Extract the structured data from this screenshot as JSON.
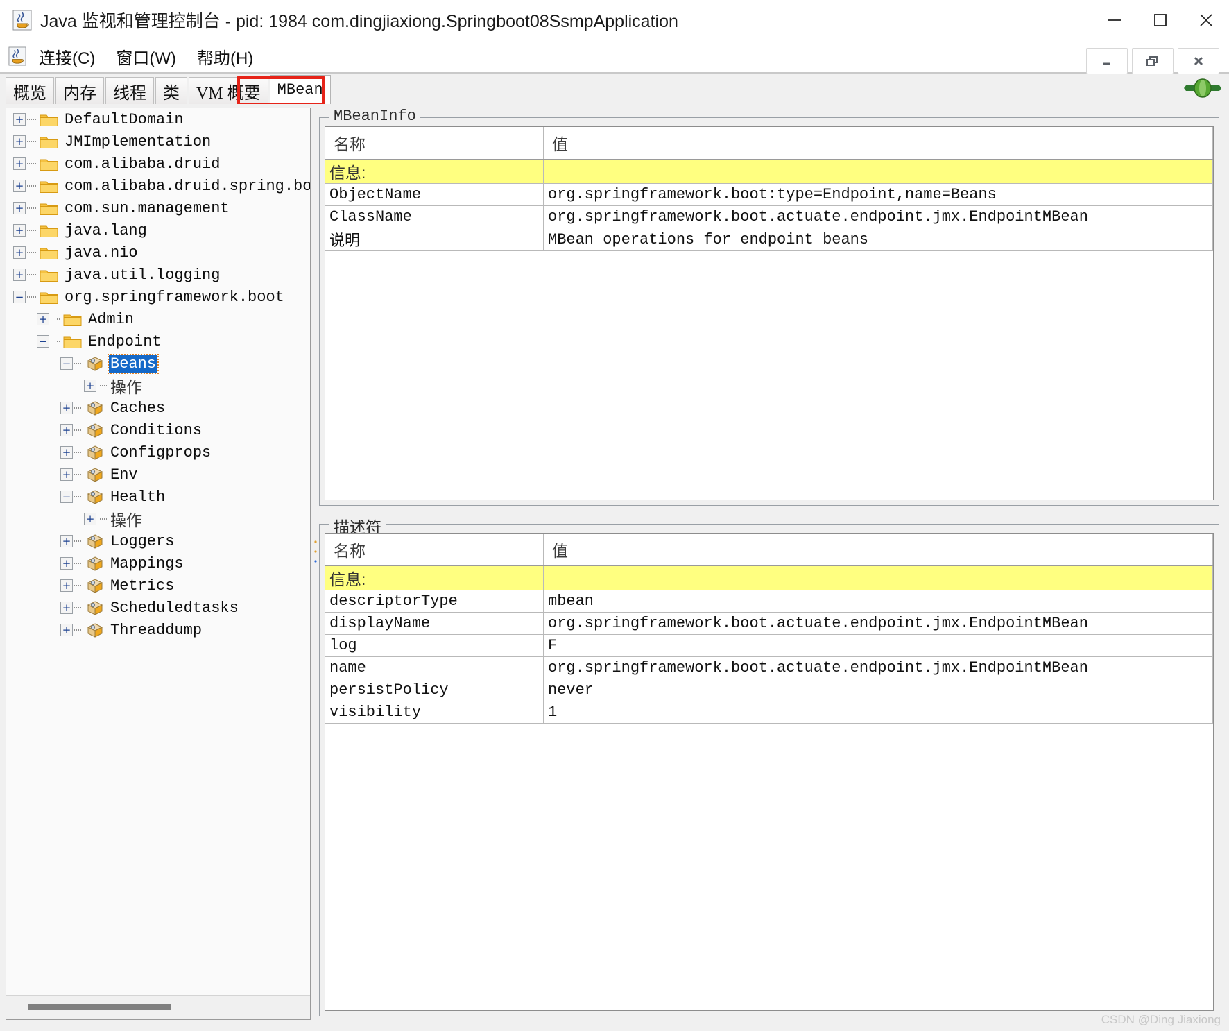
{
  "window": {
    "title": "Java 监视和管理控制台 - pid: 1984 com.dingjiaxiong.Springboot08SsmpApplication",
    "app_icon": "java-cup-icon",
    "controls": [
      {
        "name": "minimize-button",
        "glyph": "minimize-icon"
      },
      {
        "name": "maximize-button",
        "glyph": "maximize-icon"
      },
      {
        "name": "close-button",
        "glyph": "close-icon"
      }
    ]
  },
  "menubar": {
    "icon": "java-cup-icon",
    "items": [
      {
        "label": "连接(C)",
        "name": "menu-connection"
      },
      {
        "label": "窗口(W)",
        "name": "menu-window"
      },
      {
        "label": "帮助(H)",
        "name": "menu-help"
      }
    ],
    "mdi_controls": [
      {
        "name": "mdi-minimize-button",
        "glyph": "minimize-icon"
      },
      {
        "name": "mdi-restore-button",
        "glyph": "restore-icon"
      },
      {
        "name": "mdi-close-button",
        "glyph": "close-icon"
      }
    ]
  },
  "tabs": {
    "items": [
      {
        "label": "概览",
        "active": false
      },
      {
        "label": "内存",
        "active": false
      },
      {
        "label": "线程",
        "active": false
      },
      {
        "label": "类",
        "active": false
      },
      {
        "label": "VM 概要",
        "active": false
      },
      {
        "label": "MBean",
        "active": true
      }
    ],
    "highlight_color": "#e62419",
    "connector_icon": "connector-plug-icon"
  },
  "tree": {
    "nodes": [
      {
        "label": "DefaultDomain",
        "indent": 0,
        "toggle": "+",
        "icon": "folder-icon"
      },
      {
        "label": "JMImplementation",
        "indent": 0,
        "toggle": "+",
        "icon": "folder-icon"
      },
      {
        "label": "com.alibaba.druid",
        "indent": 0,
        "toggle": "+",
        "icon": "folder-icon"
      },
      {
        "label": "com.alibaba.druid.spring.boot.",
        "indent": 0,
        "toggle": "+",
        "icon": "folder-icon"
      },
      {
        "label": "com.sun.management",
        "indent": 0,
        "toggle": "+",
        "icon": "folder-icon"
      },
      {
        "label": "java.lang",
        "indent": 0,
        "toggle": "+",
        "icon": "folder-icon"
      },
      {
        "label": "java.nio",
        "indent": 0,
        "toggle": "+",
        "icon": "folder-icon"
      },
      {
        "label": "java.util.logging",
        "indent": 0,
        "toggle": "+",
        "icon": "folder-icon"
      },
      {
        "label": "org.springframework.boot",
        "indent": 0,
        "toggle": "-",
        "icon": "folder-icon"
      },
      {
        "label": "Admin",
        "indent": 1,
        "toggle": "+",
        "icon": "folder-icon"
      },
      {
        "label": "Endpoint",
        "indent": 1,
        "toggle": "-",
        "icon": "folder-icon"
      },
      {
        "label": "Beans",
        "indent": 2,
        "toggle": "-",
        "icon": "mbean-icon",
        "selected": true
      },
      {
        "label": "操作",
        "indent": 3,
        "toggle": "+",
        "icon": "none",
        "cjk": true
      },
      {
        "label": "Caches",
        "indent": 2,
        "toggle": "+",
        "icon": "mbean-icon"
      },
      {
        "label": "Conditions",
        "indent": 2,
        "toggle": "+",
        "icon": "mbean-icon"
      },
      {
        "label": "Configprops",
        "indent": 2,
        "toggle": "+",
        "icon": "mbean-icon"
      },
      {
        "label": "Env",
        "indent": 2,
        "toggle": "+",
        "icon": "mbean-icon"
      },
      {
        "label": "Health",
        "indent": 2,
        "toggle": "-",
        "icon": "mbean-icon"
      },
      {
        "label": "操作",
        "indent": 3,
        "toggle": "+",
        "icon": "none",
        "cjk": true
      },
      {
        "label": "Loggers",
        "indent": 2,
        "toggle": "+",
        "icon": "mbean-icon"
      },
      {
        "label": "Mappings",
        "indent": 2,
        "toggle": "+",
        "icon": "mbean-icon"
      },
      {
        "label": "Metrics",
        "indent": 2,
        "toggle": "+",
        "icon": "mbean-icon"
      },
      {
        "label": "Scheduledtasks",
        "indent": 2,
        "toggle": "+",
        "icon": "mbean-icon"
      },
      {
        "label": "Threaddump",
        "indent": 2,
        "toggle": "+",
        "icon": "mbean-icon"
      }
    ]
  },
  "mbeaninfo": {
    "title": "MBeanInfo",
    "columns": [
      "名称",
      "值"
    ],
    "rows": [
      {
        "name": "信息:",
        "value": "",
        "highlight": true,
        "cjk": true
      },
      {
        "name": "ObjectName",
        "value": "org.springframework.boot:type=Endpoint,name=Beans"
      },
      {
        "name": "ClassName",
        "value": "org.springframework.boot.actuate.endpoint.jmx.EndpointMBean"
      },
      {
        "name": "说明",
        "value": "MBean operations for endpoint beans",
        "cjk": true
      }
    ]
  },
  "descriptor": {
    "title": "描述符",
    "columns": [
      "名称",
      "值"
    ],
    "rows": [
      {
        "name": "信息:",
        "value": "",
        "highlight": true,
        "cjk": true
      },
      {
        "name": "descriptorType",
        "value": "mbean"
      },
      {
        "name": "displayName",
        "value": "org.springframework.boot.actuate.endpoint.jmx.EndpointMBean"
      },
      {
        "name": "log",
        "value": "F"
      },
      {
        "name": "name",
        "value": "org.springframework.boot.actuate.endpoint.jmx.EndpointMBean"
      },
      {
        "name": "persistPolicy",
        "value": "never"
      },
      {
        "name": "visibility",
        "value": "1"
      }
    ]
  },
  "watermark": "CSDN @Ding Jiaxiong"
}
